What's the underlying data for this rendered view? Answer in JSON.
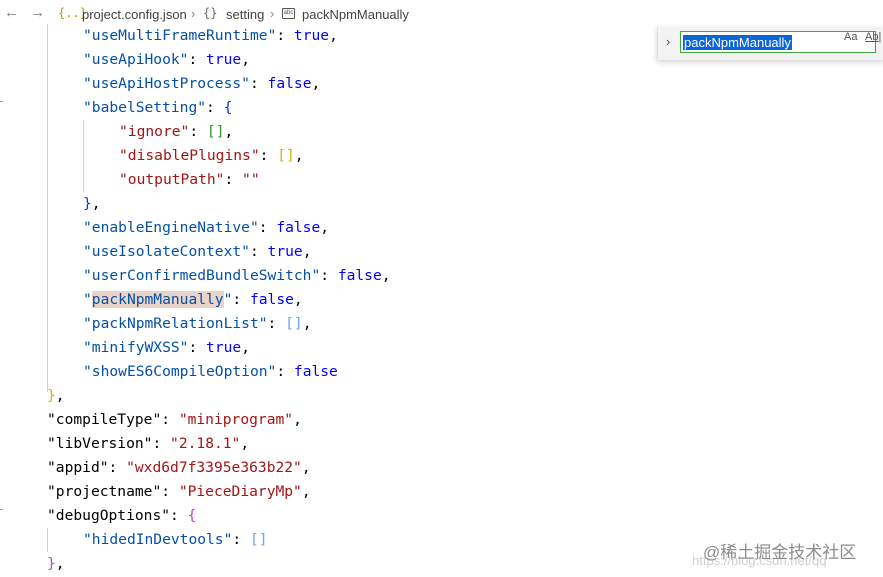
{
  "breadcrumb": {
    "back": "←",
    "forward": "→",
    "file_icon_glyph": "{..}",
    "file_name": "project.config.json",
    "sep1": "›",
    "object_icon_glyph": "{}",
    "object_name": "setting",
    "sep2": "›",
    "string_icon_glyph": "abc",
    "property_name": "packNpmManually"
  },
  "find_widget": {
    "toggle_glyph": "›",
    "search_value": "packNpmManually",
    "match_case_label": "Aa",
    "whole_word_label": "Ab|"
  },
  "code": {
    "lines": [
      {
        "key": "useMultiFrameRuntime",
        "value": "true",
        "end": ","
      },
      {
        "key": "useApiHook",
        "value": "true",
        "end": ","
      },
      {
        "key": "useApiHostProcess",
        "value": "false",
        "end": ","
      },
      {
        "key": "babelSetting",
        "open": "{"
      },
      {
        "key": "ignore",
        "open": "[",
        "close": "]",
        "end": ","
      },
      {
        "key": "disablePlugins",
        "open": "[",
        "close": "]",
        "end": ","
      },
      {
        "key": "outputPath",
        "str": "\"\""
      },
      {
        "close": "}",
        "end": ","
      },
      {
        "key": "enableEngineNative",
        "value": "false",
        "end": ","
      },
      {
        "key": "useIsolateContext",
        "value": "true",
        "end": ","
      },
      {
        "key": "userConfirmedBundleSwitch",
        "value": "false",
        "end": ","
      },
      {
        "key": "packNpmManually",
        "value": "false",
        "end": ","
      },
      {
        "key": "packNpmRelationList",
        "open": "[",
        "close": "]",
        "end": ","
      },
      {
        "key": "minifyWXSS",
        "value": "true",
        "end": ","
      },
      {
        "key": "showES6CompileOption",
        "value": "false"
      },
      {
        "close": "}",
        "end": ","
      },
      {
        "key": "compileType",
        "str": "\"miniprogram\"",
        "end": ","
      },
      {
        "key": "libVersion",
        "str": "\"2.18.1\"",
        "end": ","
      },
      {
        "key": "appid",
        "str": "\"wxd6d7f3395e363b22\"",
        "end": ","
      },
      {
        "key": "projectname",
        "str": "\"PieceDiaryMp\"",
        "end": ","
      },
      {
        "key": "debugOptions",
        "open": "{"
      },
      {
        "key": "hidedInDevtools",
        "open": "[",
        "close": "]"
      },
      {
        "close": "}",
        "end": ","
      }
    ]
  },
  "watermark": {
    "text": "@稀土掘金技术社区",
    "url": "https://blog.csdn.net/qq"
  }
}
